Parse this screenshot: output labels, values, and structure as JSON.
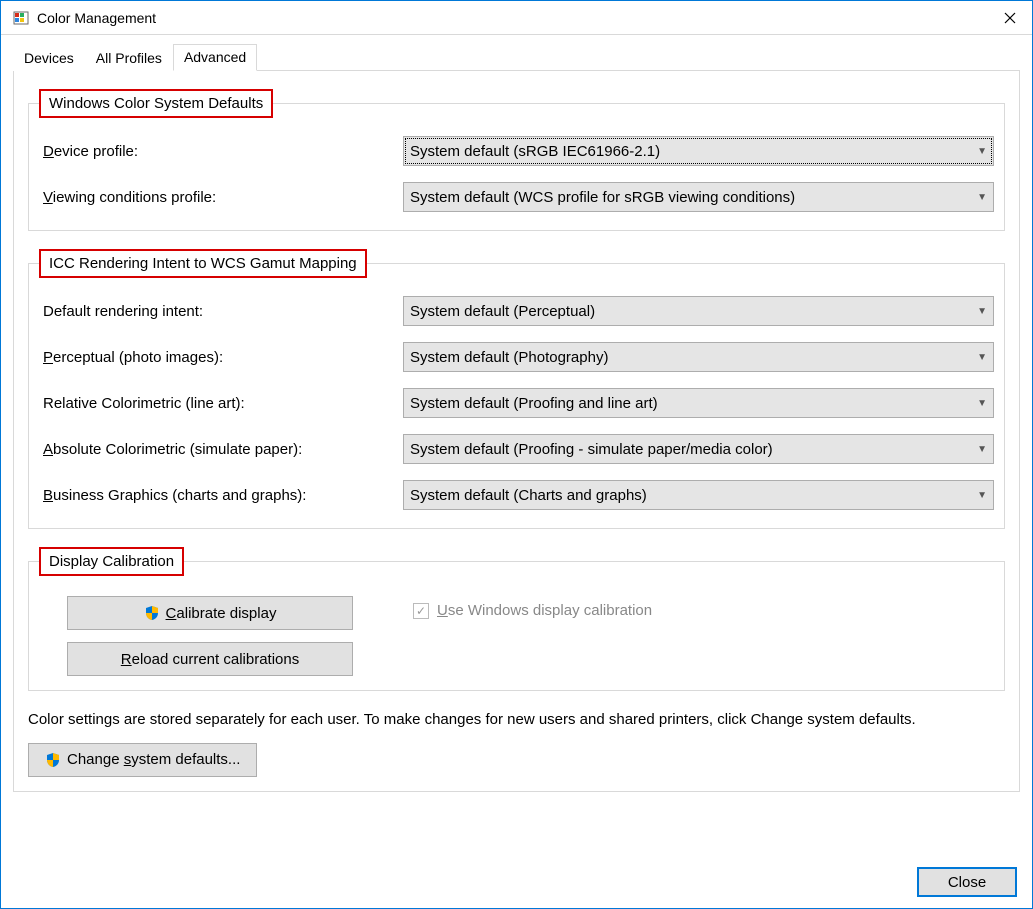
{
  "window": {
    "title": "Color Management"
  },
  "tabs": {
    "devices": "Devices",
    "allProfiles": "All Profiles",
    "advanced": "Advanced"
  },
  "groups": {
    "wcs": {
      "legend": "Windows Color System Defaults",
      "deviceProfileLabel": "Device profile:",
      "deviceProfileValue": "System default (sRGB IEC61966-2.1)",
      "viewingLabel": "Viewing conditions profile:",
      "viewingValue": "System default (WCS profile for sRGB viewing conditions)"
    },
    "icc": {
      "legend": "ICC Rendering Intent to WCS Gamut Mapping",
      "defaultIntentLabel": "Default rendering intent:",
      "defaultIntentValue": "System default (Perceptual)",
      "perceptualLabel": "Perceptual (photo images):",
      "perceptualValue": "System default (Photography)",
      "relativeLabel": "Relative Colorimetric (line art):",
      "relativeValue": "System default (Proofing and line art)",
      "absoluteLabel": "Absolute Colorimetric (simulate paper):",
      "absoluteValue": "System default (Proofing - simulate paper/media color)",
      "businessLabel": "Business Graphics (charts and graphs):",
      "businessValue": "System default (Charts and graphs)"
    },
    "calib": {
      "legend": "Display Calibration",
      "calibrateBtn": "Calibrate display",
      "reloadBtn": "Reload current calibrations",
      "useWinCalib": "Use Windows display calibration"
    }
  },
  "footer": {
    "text": "Color settings are stored separately for each user. To make changes for new users and shared printers, click Change system defaults.",
    "changeBtn": "Change system defaults...",
    "closeBtn": "Close"
  }
}
